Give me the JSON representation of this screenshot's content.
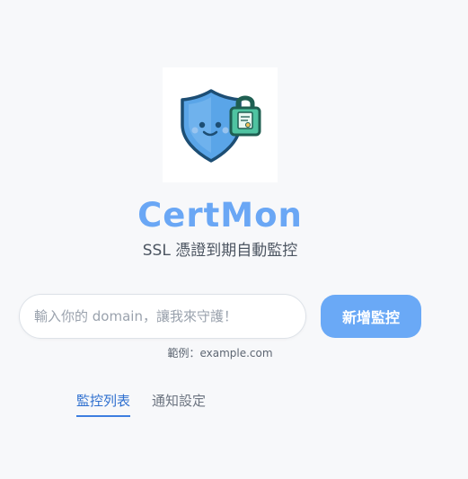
{
  "app": {
    "title": "CertMon",
    "subtitle": "SSL 憑證到期自動監控"
  },
  "logo": {
    "icon": "shield-lock-icon"
  },
  "form": {
    "domain_placeholder": "輸入你的 domain，讓我來守護！",
    "domain_value": "",
    "add_button_label": "新增監控",
    "example_hint": "範例：example.com"
  },
  "tabs": [
    {
      "label": "監控列表",
      "active": true
    },
    {
      "label": "通知設定",
      "active": false
    }
  ],
  "colors": {
    "accent": "#6aa9f6",
    "tab_active": "#2e6fcf",
    "background": "#f7f8fa"
  }
}
